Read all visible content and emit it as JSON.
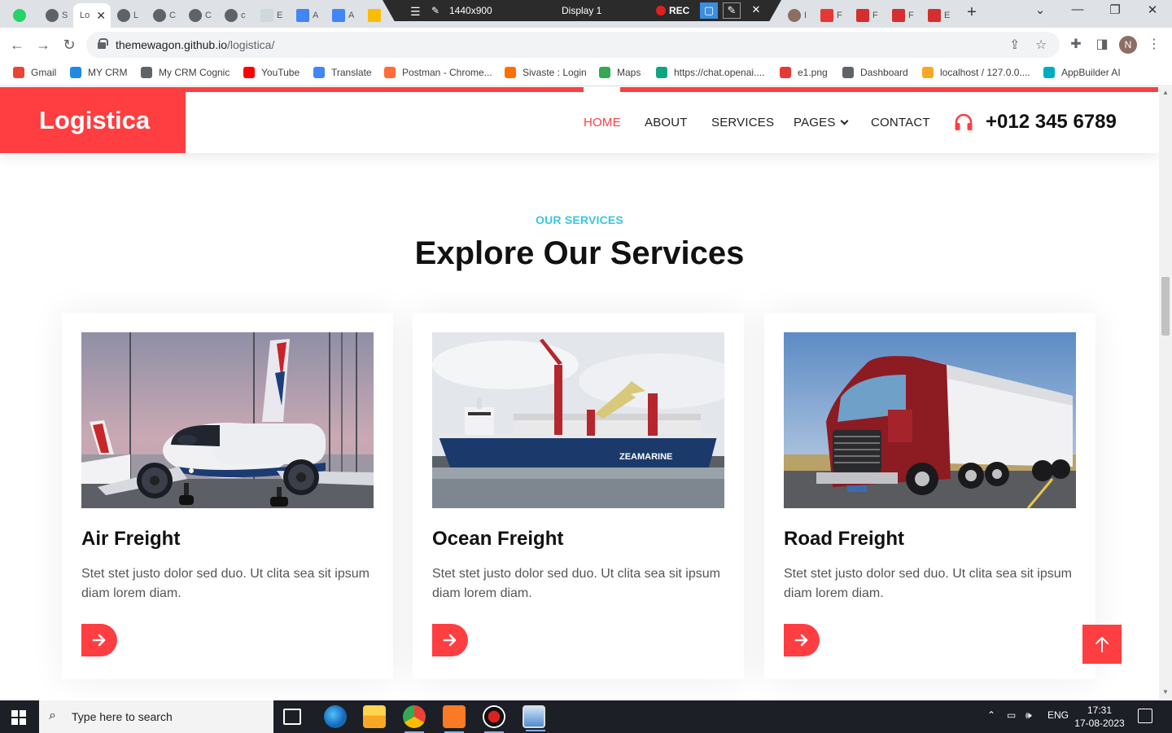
{
  "recbar": {
    "resolution": "1440x900",
    "display": "Display 1",
    "rec": "REC"
  },
  "browser": {
    "active_tab_title": "Lo",
    "url_host": "themewagon.github.io",
    "url_path": "/logistica/",
    "profile_initial": "N"
  },
  "bookmarks": [
    {
      "label": "Gmail",
      "color": "#ea4335"
    },
    {
      "label": "MY CRM",
      "color": "#1e88e5"
    },
    {
      "label": "My CRM Cognic",
      "color": "#5f6368"
    },
    {
      "label": "YouTube",
      "color": "#ff0000"
    },
    {
      "label": "Translate",
      "color": "#4285f4"
    },
    {
      "label": "Postman - Chrome...",
      "color": "#ff6c37"
    },
    {
      "label": "Sivaste : Login",
      "color": "#ff6f00"
    },
    {
      "label": "Maps",
      "color": "#34a853"
    },
    {
      "label": "https://chat.openai....",
      "color": "#10a37f"
    },
    {
      "label": "e1.png",
      "color": "#e53935"
    },
    {
      "label": "Dashboard",
      "color": "#5f6368"
    },
    {
      "label": "localhost / 127.0.0....",
      "color": "#f9a825"
    },
    {
      "label": "AppBuilder AI",
      "color": "#00acc1"
    }
  ],
  "site": {
    "brand": "Logistica",
    "nav": {
      "home": "HOME",
      "about": "ABOUT",
      "services": "SERVICES",
      "pages": "PAGES",
      "contact": "CONTACT"
    },
    "phone": "+012 345 6789",
    "accent_color": "#ff3e41",
    "eyebrow_color": "#3cc5e0"
  },
  "services_section": {
    "eyebrow": "OUR SERVICES",
    "heading": "Explore Our Services",
    "cards": [
      {
        "title": "Air Freight",
        "text": "Stet stet justo dolor sed duo. Ut clita sea sit ipsum diam lorem diam.",
        "image": "airplane-photo"
      },
      {
        "title": "Ocean Freight",
        "text": "Stet stet justo dolor sed duo. Ut clita sea sit ipsum diam lorem diam.",
        "image": "cargo-ship-photo",
        "ship_name": "ZEAMARINE"
      },
      {
        "title": "Road Freight",
        "text": "Stet stet justo dolor sed duo. Ut clita sea sit ipsum diam lorem diam.",
        "image": "truck-photo"
      }
    ]
  },
  "taskbar": {
    "search_placeholder": "Type here to search",
    "language": "ENG",
    "time": "17:31",
    "date": "17-08-2023"
  }
}
